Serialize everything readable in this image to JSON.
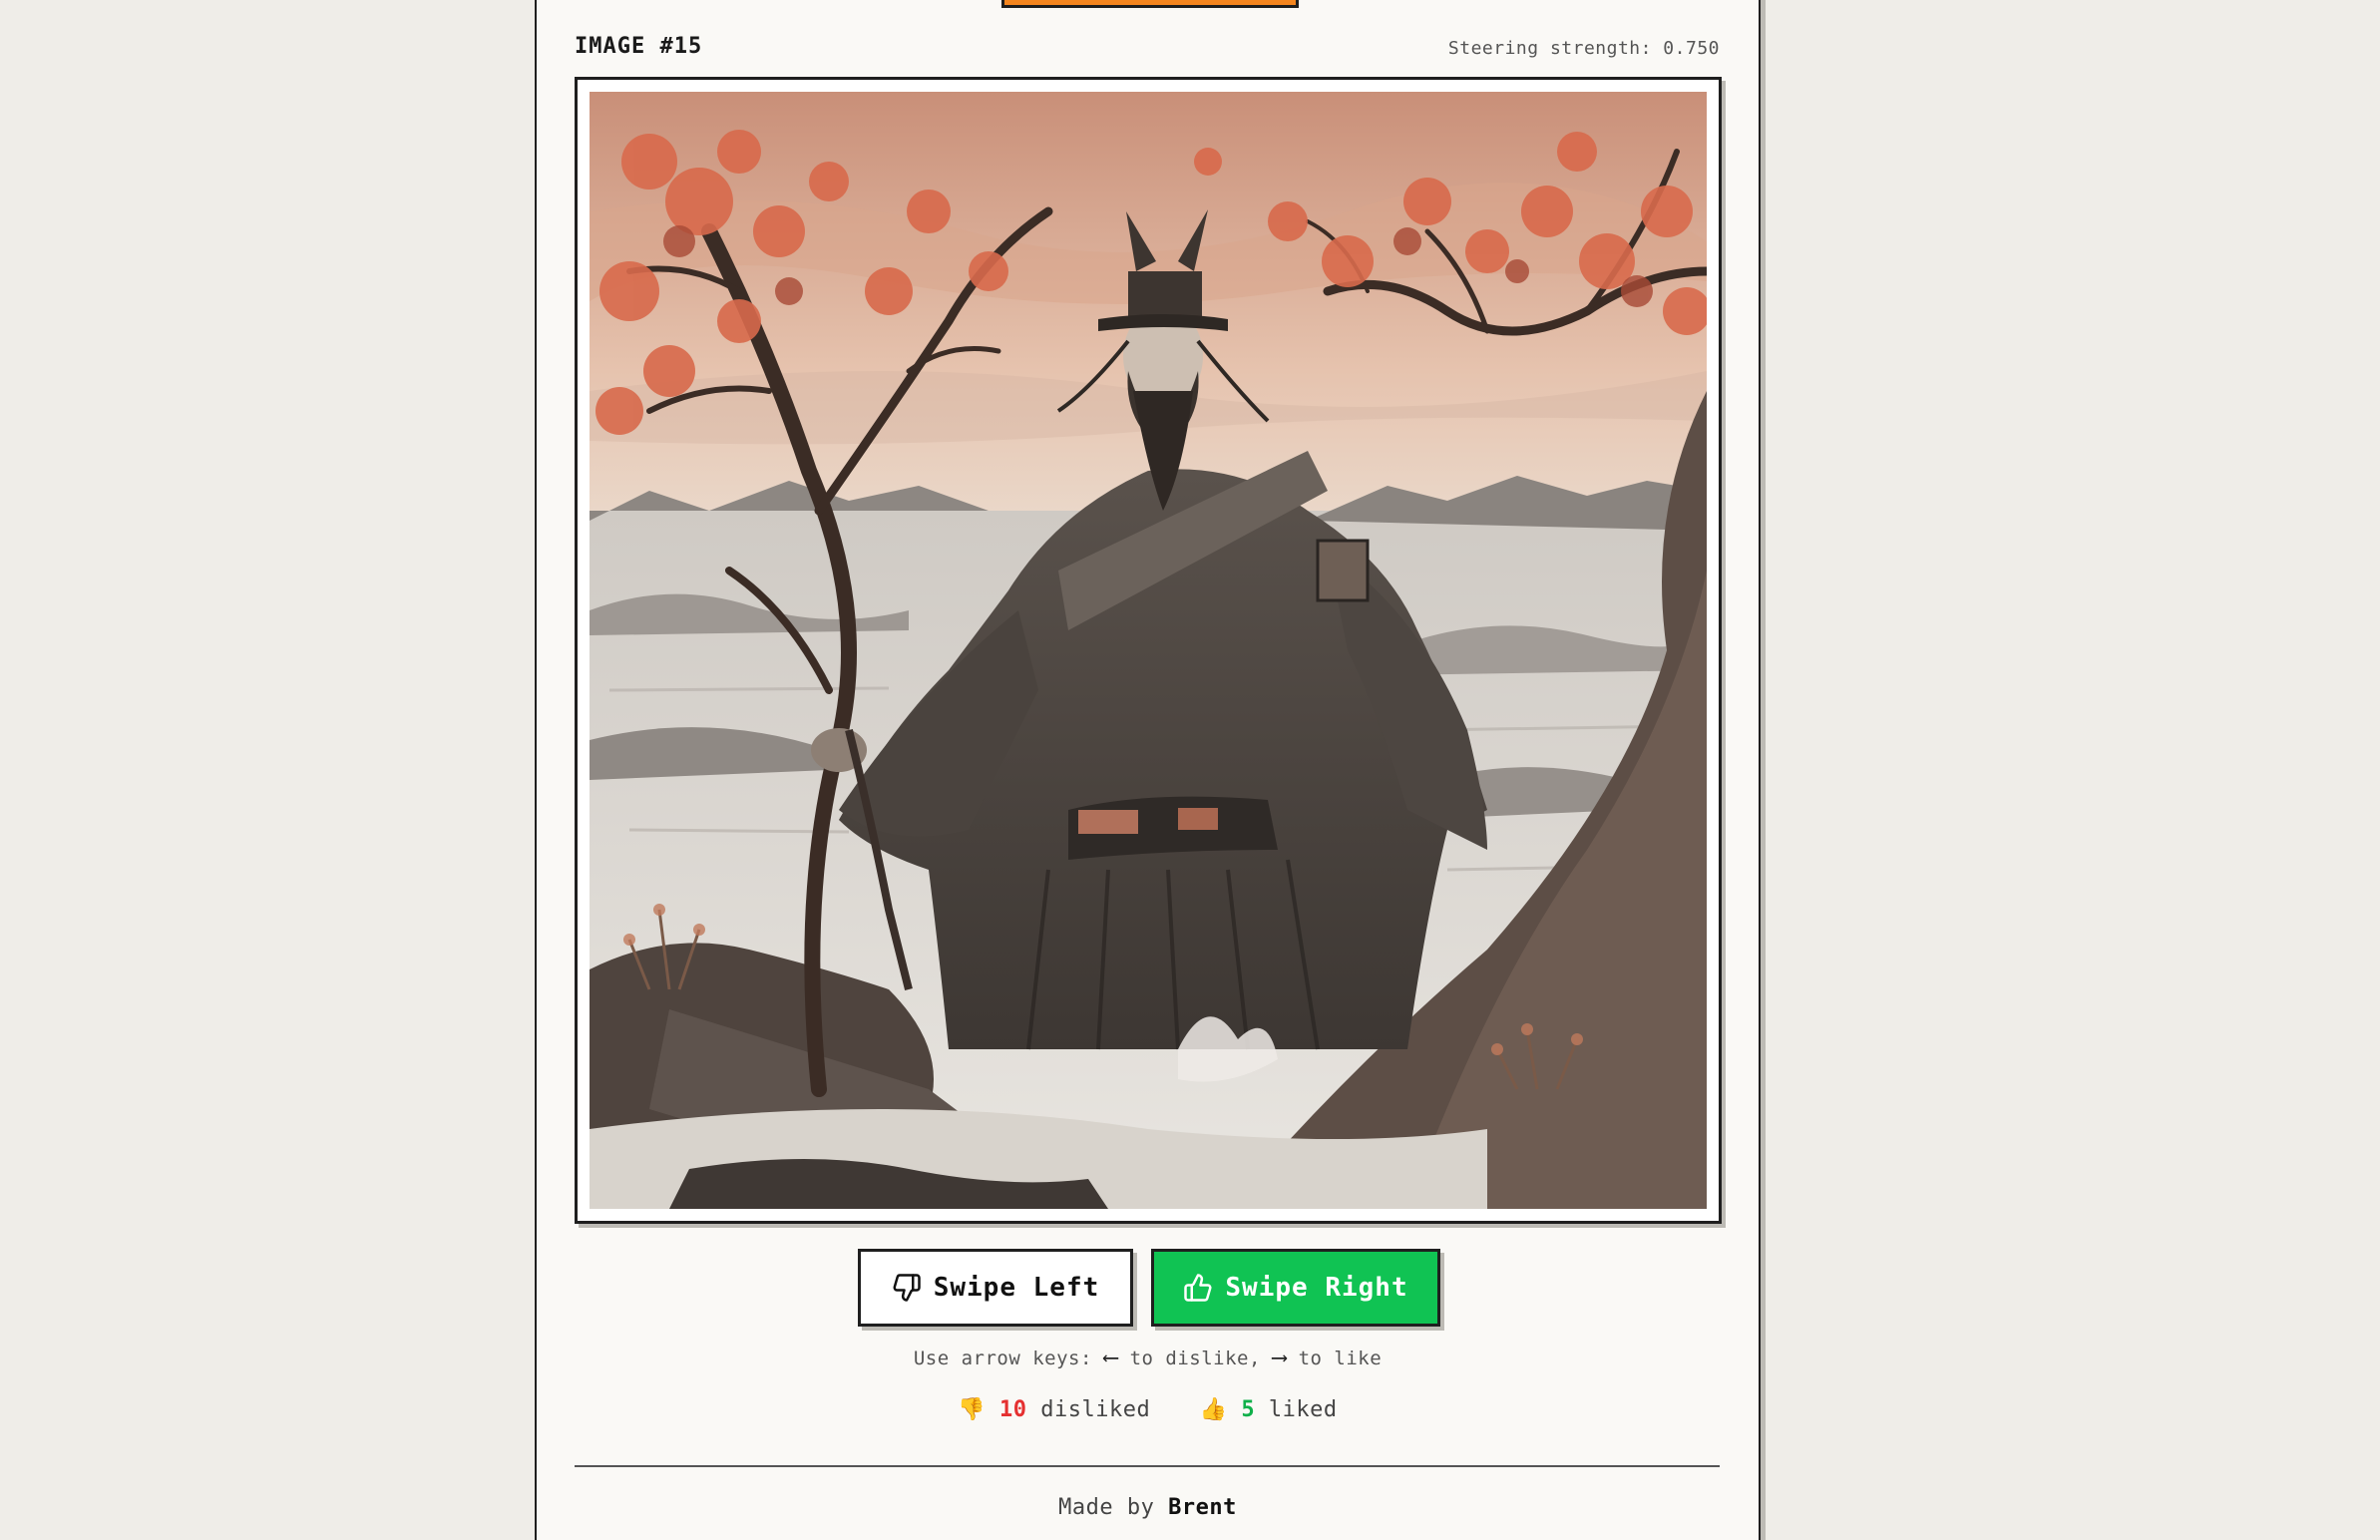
{
  "header": {
    "image_label": "IMAGE #15",
    "steering_label": "Steering strength: 0.750"
  },
  "image": {
    "subject": "ink-wash-samurai-painting"
  },
  "buttons": {
    "dislike_label": "Swipe Left",
    "dislike_icon": "thumbs-down-icon",
    "like_label": "Swipe Right",
    "like_icon": "thumbs-up-icon",
    "like_color": "#10c353",
    "accent_color": "#f5861f"
  },
  "hint": {
    "prefix": "Use arrow keys:",
    "left_arrow": "⟵",
    "left_text": "to dislike,",
    "right_arrow": "⟶",
    "right_text": "to like"
  },
  "stats": {
    "dislike_emoji": "👎",
    "disliked_count": "10",
    "disliked_label": "disliked",
    "like_emoji": "👍",
    "liked_count": "5",
    "liked_label": "liked"
  },
  "footer": {
    "made_by": "Made by",
    "author": "Brent"
  }
}
